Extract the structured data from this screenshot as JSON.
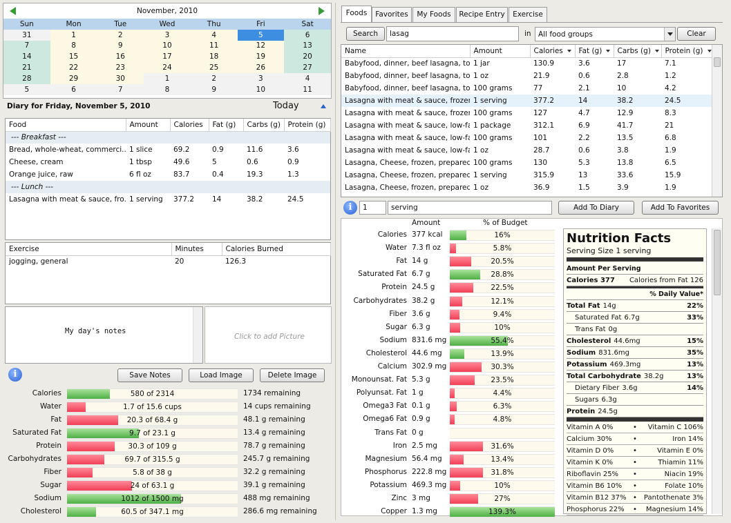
{
  "calendar": {
    "title": "November, 2010",
    "weekdays": [
      "Sun",
      "Mon",
      "Tue",
      "Wed",
      "Thu",
      "Fri",
      "Sat"
    ],
    "weeks": [
      [
        [
          "31",
          "o"
        ],
        [
          "1",
          "c"
        ],
        [
          "2",
          "c"
        ],
        [
          "3",
          "c"
        ],
        [
          "4",
          "c"
        ],
        [
          "5",
          "s"
        ],
        [
          "6",
          "w"
        ]
      ],
      [
        [
          "7",
          "w"
        ],
        [
          "8",
          "c"
        ],
        [
          "9",
          "c"
        ],
        [
          "10",
          "c"
        ],
        [
          "11",
          "c"
        ],
        [
          "12",
          "c"
        ],
        [
          "13",
          "w"
        ]
      ],
      [
        [
          "14",
          "w"
        ],
        [
          "15",
          "c"
        ],
        [
          "16",
          "c"
        ],
        [
          "17",
          "c"
        ],
        [
          "18",
          "c"
        ],
        [
          "19",
          "c"
        ],
        [
          "20",
          "w"
        ]
      ],
      [
        [
          "21",
          "w"
        ],
        [
          "22",
          "c"
        ],
        [
          "23",
          "c"
        ],
        [
          "24",
          "c"
        ],
        [
          "25",
          "c"
        ],
        [
          "26",
          "c"
        ],
        [
          "27",
          "w"
        ]
      ],
      [
        [
          "28",
          "w"
        ],
        [
          "29",
          "c"
        ],
        [
          "30",
          "c"
        ],
        [
          "1",
          "o"
        ],
        [
          "2",
          "o"
        ],
        [
          "3",
          "o"
        ],
        [
          "4",
          "o"
        ]
      ],
      [
        [
          "5",
          "o"
        ],
        [
          "6",
          "o"
        ],
        [
          "7",
          "o"
        ],
        [
          "8",
          "o"
        ],
        [
          "9",
          "o"
        ],
        [
          "10",
          "o"
        ],
        [
          "11",
          "o"
        ]
      ]
    ]
  },
  "diary": {
    "title": "Diary for Friday, November 5, 2010",
    "today_label": "Today"
  },
  "food_log": {
    "headers": [
      "Food",
      "Amount",
      "Calories",
      "Fat (g)",
      "Carbs (g)",
      "Protein (g)"
    ],
    "rows": [
      {
        "meal": "--- Breakfast ---"
      },
      {
        "cells": [
          "Bread, whole-wheat, commerci...",
          "1 slice",
          "69.2",
          "0.9",
          "11.6",
          "3.6"
        ]
      },
      {
        "cells": [
          "Cheese, cream",
          "1 tbsp",
          "49.6",
          "5",
          "0.6",
          "0.9"
        ]
      },
      {
        "cells": [
          "Orange juice, raw",
          "6 fl oz",
          "83.7",
          "0.4",
          "19.3",
          "1.3"
        ]
      },
      {
        "meal": "--- Lunch ---"
      },
      {
        "cells": [
          "Lasagna with meat & sauce, fro...",
          "1 serving",
          "377.2",
          "14",
          "38.2",
          "24.5"
        ]
      }
    ]
  },
  "exercise_log": {
    "headers": [
      "Exercise",
      "Minutes",
      "Calories Burned"
    ],
    "rows": [
      [
        "jogging, general",
        "20",
        "126.3"
      ]
    ]
  },
  "notes": {
    "text": "My day's notes",
    "picture_placeholder": "Click to add Picture"
  },
  "buttons": {
    "save_notes": "Save Notes",
    "load_image": "Load Image",
    "delete_image": "Delete Image",
    "search": "Search",
    "clear": "Clear",
    "add_to_diary": "Add To Diary",
    "add_to_favorites": "Add To Favorites"
  },
  "daily_summary": [
    {
      "label": "Calories",
      "text": "580 of 2314",
      "remaining": "1734  remaining",
      "fraction": 0.25,
      "color": "green"
    },
    {
      "label": "Water",
      "text": "1.7 of 15.6  cups",
      "remaining": "14  cups remaining",
      "fraction": 0.11,
      "color": "red"
    },
    {
      "label": "Fat",
      "text": "20.3 of 68.4  g",
      "remaining": "48.1  g remaining",
      "fraction": 0.3,
      "color": "red"
    },
    {
      "label": "Saturated Fat",
      "text": "9.7 of 23.1  g",
      "remaining": "13.4  g remaining",
      "fraction": 0.42,
      "color": "green"
    },
    {
      "label": "Protein",
      "text": "30.3 of 109  g",
      "remaining": "78.7  g remaining",
      "fraction": 0.28,
      "color": "red"
    },
    {
      "label": "Carbohydrates",
      "text": "69.7 of 315.5  g",
      "remaining": "245.7  g remaining",
      "fraction": 0.22,
      "color": "red"
    },
    {
      "label": "Fiber",
      "text": "5.8 of 38  g",
      "remaining": "32.2  g remaining",
      "fraction": 0.15,
      "color": "red"
    },
    {
      "label": "Sugar",
      "text": "24 of 63.1  g",
      "remaining": "39.1  g remaining",
      "fraction": 0.38,
      "color": "red"
    },
    {
      "label": "Sodium",
      "text": "1012 of 1500  mg",
      "remaining": "488  mg remaining",
      "fraction": 0.67,
      "color": "green"
    },
    {
      "label": "Cholesterol",
      "text": "60.5 of 347.1  mg",
      "remaining": "286.6  mg remaining",
      "fraction": 0.17,
      "color": "green"
    }
  ],
  "tabs": [
    "Foods",
    "Favorites",
    "My Foods",
    "Recipe Entry",
    "Exercise"
  ],
  "search": {
    "value": "lasag",
    "in_label": "in",
    "group": "All food groups"
  },
  "results": {
    "headers": [
      "Name",
      "Amount",
      "Calories",
      "Fat (g)",
      "Carbs (g)",
      "Protein (g)"
    ],
    "rows": [
      [
        "Babyfood, dinner, beef lasagna, toddler",
        "1 jar",
        "130.9",
        "3.6",
        "17",
        "7.1"
      ],
      [
        "Babyfood, dinner, beef lasagna, toddler",
        "1 oz",
        "21.9",
        "0.6",
        "2.8",
        "1.2"
      ],
      [
        "Babyfood, dinner, beef lasagna, toddler",
        "100 grams",
        "77",
        "2.1",
        "10",
        "4.2"
      ],
      [
        "Lasagna with meat & sauce, frozen entree",
        "1 serving",
        "377.2",
        "14",
        "38.2",
        "24.5"
      ],
      [
        "Lasagna with meat & sauce, frozen entree",
        "100 grams",
        "127",
        "4.7",
        "12.9",
        "8.3"
      ],
      [
        "Lasagna with meat & sauce, low-fat, frozen",
        "1 package",
        "312.1",
        "6.9",
        "41.7",
        "21"
      ],
      [
        "Lasagna with meat & sauce, low-fat, frozen",
        "100 grams",
        "101",
        "2.2",
        "13.5",
        "6.8"
      ],
      [
        "Lasagna with meat & sauce, low-fat, frozen",
        "1 oz",
        "28.7",
        "0.6",
        "3.8",
        "1.9"
      ],
      [
        "Lasagna, Cheese, frozen, prepared",
        "100 grams",
        "130",
        "5.3",
        "13.8",
        "6.5"
      ],
      [
        "Lasagna, Cheese, frozen, prepared",
        "1 serving",
        "315.9",
        "13",
        "33.6",
        "15.9"
      ],
      [
        "Lasagna, Cheese, frozen, prepared",
        "1 oz",
        "36.9",
        "1.5",
        "3.9",
        "1.9"
      ]
    ],
    "selected_index": 3
  },
  "quantity": {
    "value": "1",
    "unit": "serving"
  },
  "budget": {
    "headers": [
      "Amount",
      "% of Budget"
    ],
    "rows": [
      {
        "label": "Calories",
        "amount": "377  kcal",
        "pct": "16%",
        "fraction": 0.16,
        "color": "green"
      },
      {
        "label": "Water",
        "amount": "7.3  fl oz",
        "pct": "5.8%",
        "fraction": 0.058,
        "color": "red"
      },
      {
        "label": "Fat",
        "amount": "14  g",
        "pct": "20.5%",
        "fraction": 0.205,
        "color": "red"
      },
      {
        "label": "Saturated Fat",
        "amount": "6.7  g",
        "pct": "28.8%",
        "fraction": 0.288,
        "color": "green"
      },
      {
        "label": "Protein",
        "amount": "24.5  g",
        "pct": "22.5%",
        "fraction": 0.225,
        "color": "red"
      },
      {
        "label": "Carbohydrates",
        "amount": "38.2  g",
        "pct": "12.1%",
        "fraction": 0.121,
        "color": "red"
      },
      {
        "label": "Fiber",
        "amount": "3.6  g",
        "pct": "9.4%",
        "fraction": 0.094,
        "color": "red"
      },
      {
        "label": "Sugar",
        "amount": "6.3  g",
        "pct": "10%",
        "fraction": 0.1,
        "color": "red"
      },
      {
        "label": "Sodium",
        "amount": "831.6  mg",
        "pct": "55.4%",
        "fraction": 0.554,
        "color": "green"
      },
      {
        "label": "Cholesterol",
        "amount": "44.6  mg",
        "pct": "13.9%",
        "fraction": 0.139,
        "color": "green"
      },
      {
        "label": "Calcium",
        "amount": "302.9  mg",
        "pct": "30.3%",
        "fraction": 0.303,
        "color": "red"
      },
      {
        "label": "Monounsat. Fat",
        "amount": "5.3  g",
        "pct": "23.5%",
        "fraction": 0.235,
        "color": "red"
      },
      {
        "label": "Polyunsat. Fat",
        "amount": "1  g",
        "pct": "4.4%",
        "fraction": 0.044,
        "color": "red"
      },
      {
        "label": "Omega3 Fat",
        "amount": "0.1  g",
        "pct": "6.3%",
        "fraction": 0.063,
        "color": "red"
      },
      {
        "label": "Omega6 Fat",
        "amount": "0.9  g",
        "pct": "4.8%",
        "fraction": 0.048,
        "color": "red"
      },
      {
        "label": "Trans Fat",
        "amount": "0  g",
        "pct": "",
        "fraction": 0,
        "color": "red"
      },
      {
        "label": "Iron",
        "amount": "2.5  mg",
        "pct": "31.6%",
        "fraction": 0.316,
        "color": "red"
      },
      {
        "label": "Magnesium",
        "amount": "56.4  mg",
        "pct": "13.4%",
        "fraction": 0.134,
        "color": "red"
      },
      {
        "label": "Phosphorus",
        "amount": "222.8  mg",
        "pct": "31.8%",
        "fraction": 0.318,
        "color": "red"
      },
      {
        "label": "Potassium",
        "amount": "469.3  mg",
        "pct": "10%",
        "fraction": 0.1,
        "color": "red"
      },
      {
        "label": "Zinc",
        "amount": "3  mg",
        "pct": "27%",
        "fraction": 0.27,
        "color": "red"
      },
      {
        "label": "Copper",
        "amount": "1.3  mg",
        "pct": "139.3%",
        "fraction": 1.0,
        "color": "green"
      }
    ]
  },
  "nutrition_facts": {
    "title": "Nutrition Facts",
    "serving_size": "Serving Size 1 serving",
    "amount_per_serving": "Amount Per Serving",
    "calories": "Calories 377",
    "calories_from_fat": "Calories from Fat 126",
    "dv_header": "% Daily Value*",
    "rows": [
      {
        "label": "Total Fat",
        "value": "14g",
        "dv": "22%",
        "bold": true,
        "indent": false
      },
      {
        "label": "Saturated Fat",
        "value": "6.7g",
        "dv": "33%",
        "bold": false,
        "indent": true
      },
      {
        "label": "Trans Fat",
        "value": "0g",
        "dv": "",
        "bold": false,
        "indent": true
      },
      {
        "label": "Cholesterol",
        "value": "44.6mg",
        "dv": "15%",
        "bold": true,
        "indent": false
      },
      {
        "label": "Sodium",
        "value": "831.6mg",
        "dv": "35%",
        "bold": true,
        "indent": false
      },
      {
        "label": "Potassium",
        "value": "469.3mg",
        "dv": "13%",
        "bold": true,
        "indent": false
      },
      {
        "label": "Total Carbohydrate",
        "value": "38.2g",
        "dv": "13%",
        "bold": true,
        "indent": false
      },
      {
        "label": "Dietary Fiber",
        "value": "3.6g",
        "dv": "14%",
        "bold": false,
        "indent": true
      },
      {
        "label": "Sugars",
        "value": "6.3g",
        "dv": "",
        "bold": false,
        "indent": true
      },
      {
        "label": "Protein",
        "value": "24.5g",
        "dv": "",
        "bold": true,
        "indent": false
      }
    ],
    "vitamins": [
      [
        "Vitamin A  0%",
        "Vitamin C  106%"
      ],
      [
        "Calcium  30%",
        "Iron  14%"
      ],
      [
        "Vitamin D  0%",
        "Vitamin E  0%"
      ],
      [
        "Vitamin K  0%",
        "Thiamin  11%"
      ],
      [
        "Riboflavin  25%",
        "Niacin  19%"
      ],
      [
        "Vitamin B6  10%",
        "Folate  10%"
      ],
      [
        "Vitamin B12  37%",
        "Pantothenate  3%"
      ],
      [
        "Phosphorus  22%",
        "Magnesium  14%"
      ]
    ],
    "separator": "•"
  }
}
